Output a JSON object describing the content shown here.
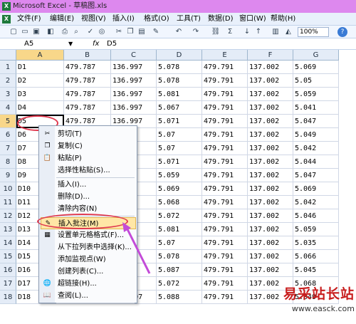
{
  "window": {
    "title": "Microsoft Excel - 草稿图.xls"
  },
  "menu": [
    "文件(F)",
    "编辑(E)",
    "视图(V)",
    "插入(I)",
    "格式(O)",
    "工具(T)",
    "数据(D)",
    "窗口(W)",
    "帮助(H)"
  ],
  "toolbar": {
    "zoom": "100%",
    "help": "?"
  },
  "formula_bar": {
    "name_box": "A5",
    "fx": "fx",
    "value": "D5"
  },
  "columns": [
    "A",
    "B",
    "C",
    "D",
    "E",
    "F",
    "G"
  ],
  "rows": [
    [
      "D1",
      "479.787",
      "136.997",
      "5.078",
      "479.791",
      "137.002",
      "5.069"
    ],
    [
      "D2",
      "479.787",
      "136.997",
      "5.078",
      "479.791",
      "137.002",
      "5.05"
    ],
    [
      "D3",
      "479.787",
      "136.997",
      "5.081",
      "479.791",
      "137.002",
      "5.059"
    ],
    [
      "D4",
      "479.787",
      "136.997",
      "5.067",
      "479.791",
      "137.002",
      "5.041"
    ],
    [
      "D5",
      "479.787",
      "136.997",
      "5.071",
      "479.791",
      "137.002",
      "5.047"
    ],
    [
      "D6",
      "",
      "",
      "5.07",
      "479.791",
      "137.002",
      "5.049"
    ],
    [
      "D7",
      "",
      "",
      "5.07",
      "479.791",
      "137.002",
      "5.042"
    ],
    [
      "D8",
      "",
      "",
      "5.071",
      "479.791",
      "137.002",
      "5.044"
    ],
    [
      "D9",
      "",
      "",
      "5.059",
      "479.791",
      "137.002",
      "5.047"
    ],
    [
      "D10",
      "",
      "",
      "5.069",
      "479.791",
      "137.002",
      "5.069"
    ],
    [
      "D11",
      "",
      "",
      "5.068",
      "479.791",
      "137.002",
      "5.042"
    ],
    [
      "D12",
      "",
      "",
      "5.072",
      "479.791",
      "137.002",
      "5.046"
    ],
    [
      "D13",
      "",
      "",
      "5.081",
      "479.791",
      "137.002",
      "5.059"
    ],
    [
      "D14",
      "",
      "",
      "5.07",
      "479.791",
      "137.002",
      "5.035"
    ],
    [
      "D15",
      "",
      "",
      "5.078",
      "479.791",
      "137.002",
      "5.066"
    ],
    [
      "D16",
      "",
      "",
      "5.087",
      "479.791",
      "137.002",
      "5.045"
    ],
    [
      "D17",
      "",
      "",
      "5.072",
      "479.791",
      "137.002",
      "5.068"
    ],
    [
      "D18",
      "",
      "136.997",
      "5.088",
      "479.791",
      "137.002",
      "5.049"
    ]
  ],
  "context_menu": {
    "items": [
      {
        "label": "剪切(T)",
        "icon": "scissors-icon",
        "glyph": "✂"
      },
      {
        "label": "复制(C)",
        "icon": "copy-icon",
        "glyph": "❐"
      },
      {
        "label": "粘贴(P)",
        "icon": "paste-icon",
        "glyph": "📋"
      },
      {
        "label": "选择性粘贴(S)...",
        "icon": "",
        "glyph": ""
      },
      {
        "label": "插入(I)...",
        "icon": "",
        "glyph": ""
      },
      {
        "label": "删除(D)...",
        "icon": "",
        "glyph": ""
      },
      {
        "label": "清除内容(N)",
        "icon": "",
        "glyph": ""
      },
      {
        "label": "插入批注(M)",
        "icon": "insert-comment-icon",
        "glyph": "✎"
      },
      {
        "label": "设置单元格格式(F)...",
        "icon": "format-cells-icon",
        "glyph": "▦"
      },
      {
        "label": "从下拉列表中选择(K)...",
        "icon": "",
        "glyph": ""
      },
      {
        "label": "添加监视点(W)",
        "icon": "",
        "glyph": ""
      },
      {
        "label": "创建列表(C)...",
        "icon": "",
        "glyph": ""
      },
      {
        "label": "超链接(H)...",
        "icon": "hyperlink-icon",
        "glyph": "🌐"
      },
      {
        "label": "查阅(L)...",
        "icon": "lookup-icon",
        "glyph": "📖"
      }
    ],
    "highlighted": "插入批注(M)"
  },
  "watermark": {
    "title": "易采站长站",
    "url": "www.easck.com"
  },
  "colors": {
    "titlebar": "#dd88ee",
    "annotation": "#e0394f",
    "arrow": "#c34bd8",
    "highlight": "#ffe7a6"
  }
}
